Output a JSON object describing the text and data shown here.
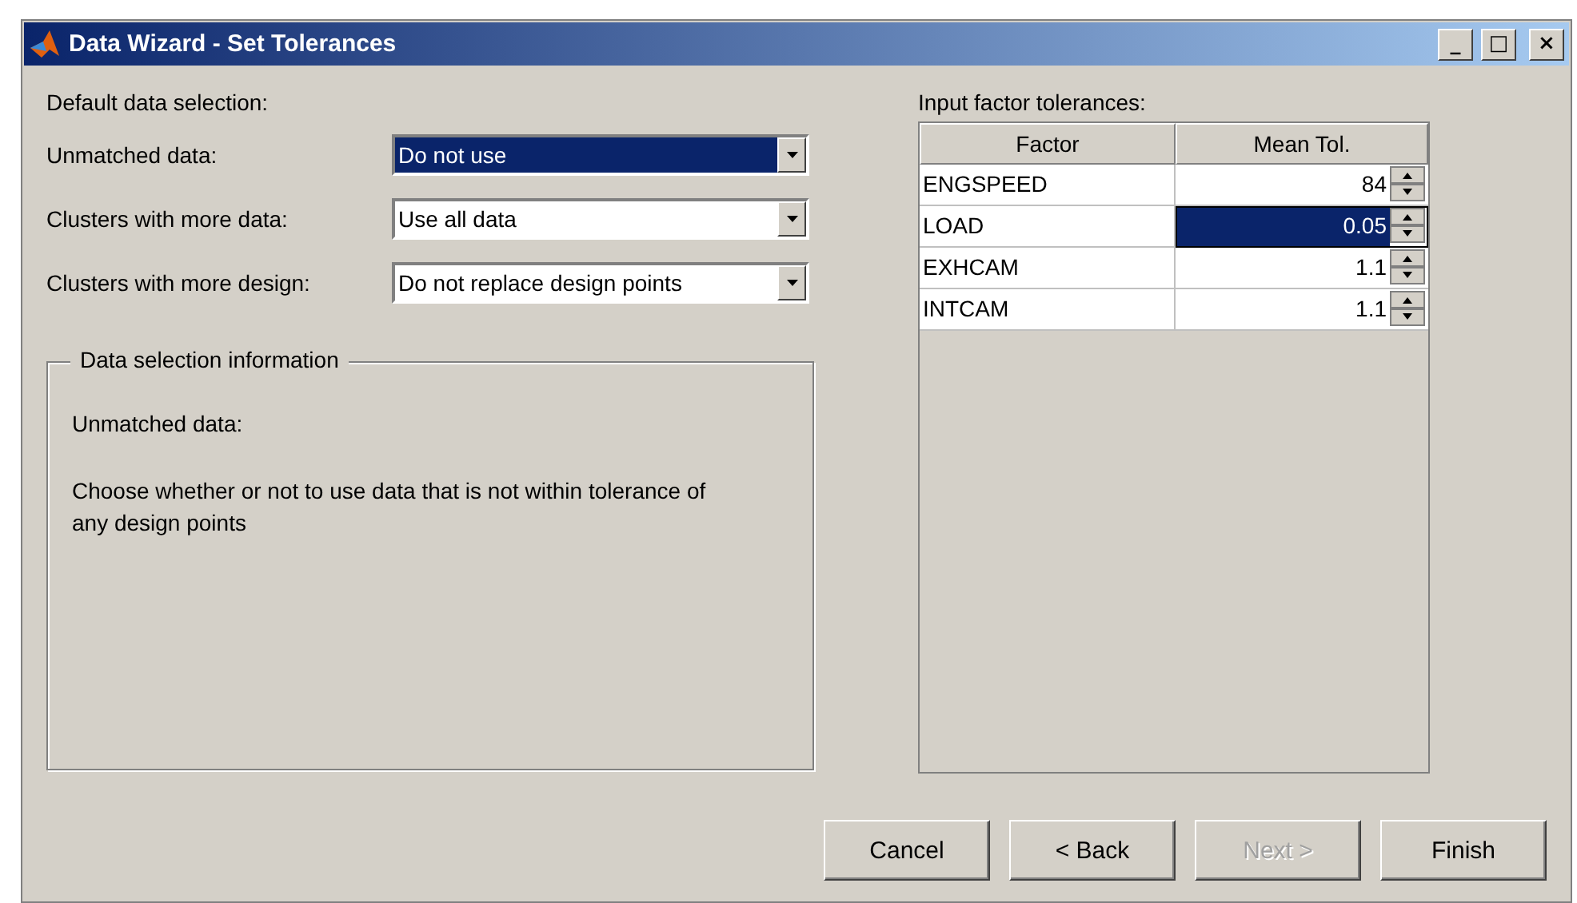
{
  "window": {
    "title": "Data Wizard - Set Tolerances",
    "controls": [
      "_",
      "□",
      "×"
    ]
  },
  "default_selection": {
    "heading": "Default data selection:",
    "fields": [
      {
        "label": "Unmatched data:",
        "value": "Do not use",
        "focused": true
      },
      {
        "label": "Clusters with more data:",
        "value": "Use all data",
        "focused": false
      },
      {
        "label": "Clusters with more design:",
        "value": "Do not replace design points",
        "focused": false
      }
    ]
  },
  "info_group": {
    "title": "Data selection information",
    "subtitle": "Unmatched data:",
    "text": "Choose whether or not to use data that is not within tolerance of any design points"
  },
  "tolerances": {
    "heading": "Input factor tolerances:",
    "columns": [
      "Factor",
      "Mean Tol."
    ],
    "rows": [
      {
        "factor": "ENGSPEED",
        "value": "84",
        "selected": false
      },
      {
        "factor": "LOAD",
        "value": "0.05",
        "selected": true
      },
      {
        "factor": "EXHCAM",
        "value": "1.1",
        "selected": false
      },
      {
        "factor": "INTCAM",
        "value": "1.1",
        "selected": false
      }
    ]
  },
  "buttons": [
    {
      "label": "Cancel",
      "disabled": false
    },
    {
      "label": "< Back",
      "disabled": false
    },
    {
      "label": "Next >",
      "disabled": true
    },
    {
      "label": "Finish",
      "disabled": false
    }
  ]
}
